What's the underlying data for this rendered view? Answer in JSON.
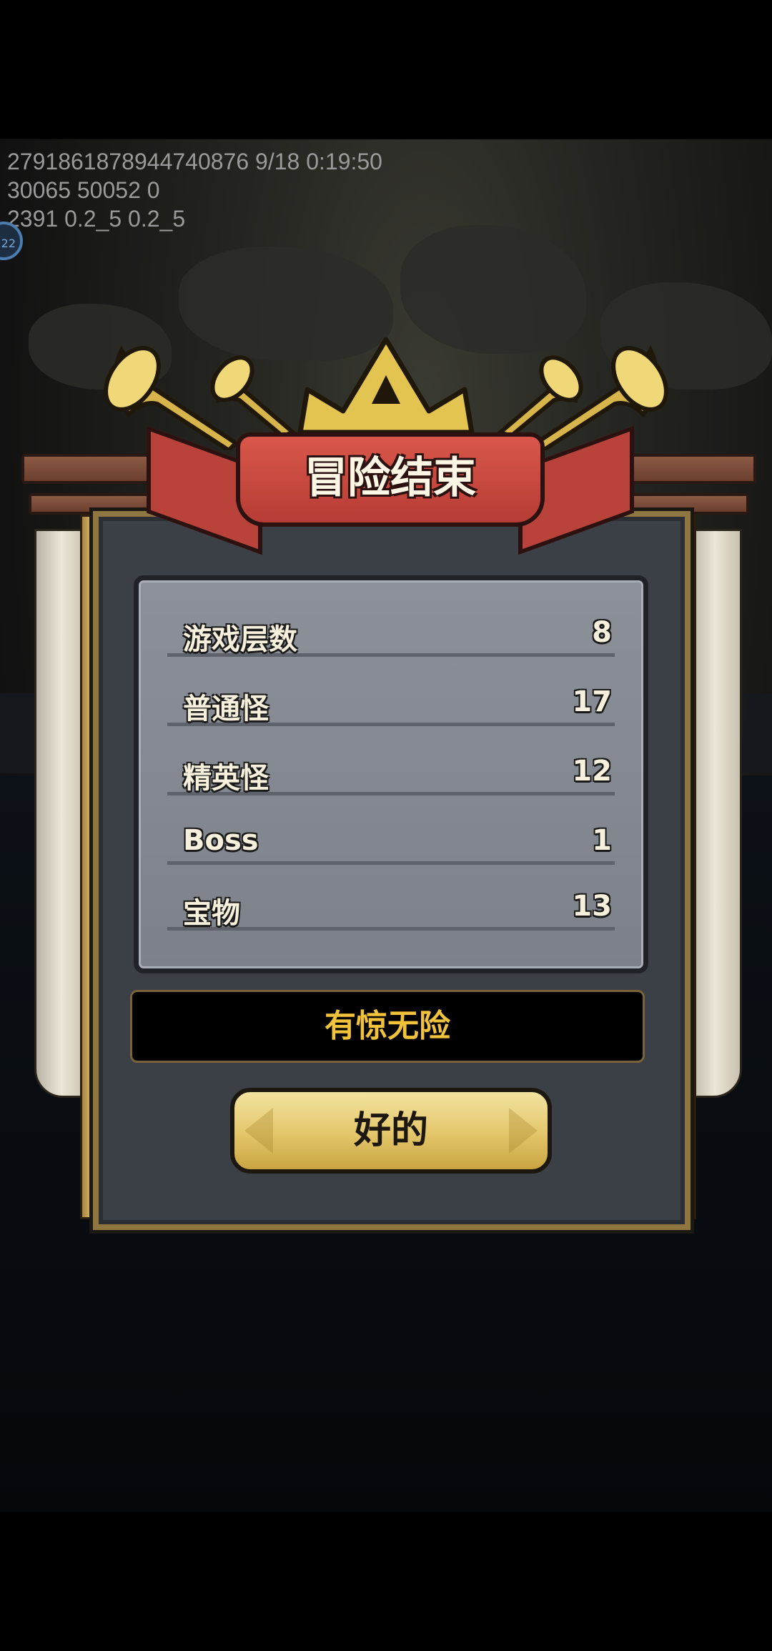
{
  "debug_lines": [
    "2791861878944740876 9/18 0:19:50",
    "30065 50052 0",
    "2391 0.2_5 0.2_5"
  ],
  "side_badge_text": "22",
  "dialog": {
    "title": "冒险结束",
    "stats": [
      {
        "label": "游戏层数",
        "value": "8"
      },
      {
        "label": "普通怪",
        "value": "17"
      },
      {
        "label": "精英怪",
        "value": "12"
      },
      {
        "label": "Boss",
        "value": "1"
      },
      {
        "label": "宝物",
        "value": "13"
      }
    ],
    "status_text": "有惊无险",
    "ok_label": "好的"
  },
  "colors": {
    "banner": "#c8473e",
    "status_text": "#f2c23a",
    "button_gold": "#e3c66a",
    "panel_gray": "#868a92",
    "frame_gold": "#8f7640"
  },
  "icons": [
    "trumpet-icon",
    "crown-icon"
  ]
}
